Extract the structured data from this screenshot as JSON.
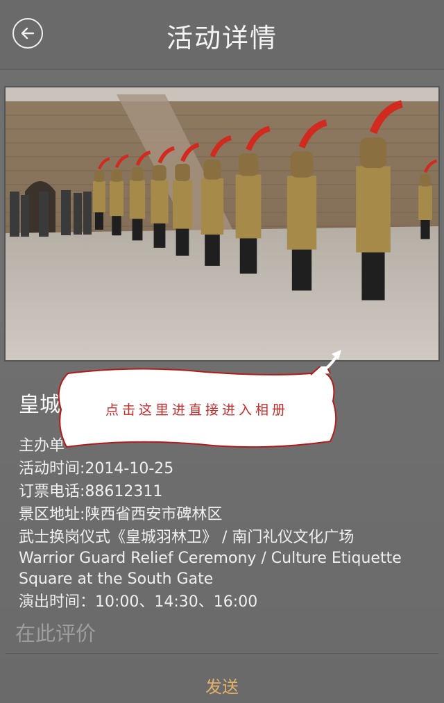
{
  "header": {
    "title": "活动详情",
    "back_icon": "arrow-left-icon"
  },
  "photo": {
    "subject": "warrior-guard-ceremony-photo"
  },
  "callout": {
    "text": "点击这里进直接进入相册"
  },
  "event": {
    "title": "皇城",
    "organizer": "主办单",
    "date": "活动时间:2014-10-25",
    "phone": "订票电话:88612311",
    "address": "景区地址:陕西省西安市碑林区",
    "desc_cn": "武士换岗仪式《皇城羽林卫》 / 南门礼仪文化广场",
    "desc_en_1": "Warrior Guard Relief Ceremony  / Culture Etiquette",
    "desc_en_2": "Square at the South Gate",
    "showtimes": "演出时间：10:00、14:30、16:00"
  },
  "comment": {
    "placeholder": "在此评价"
  },
  "send": {
    "label": "发送"
  },
  "colors": {
    "accent_send": "#e2b16a",
    "callout_text": "#c62b2b",
    "callout_border": "#b31b1b"
  }
}
